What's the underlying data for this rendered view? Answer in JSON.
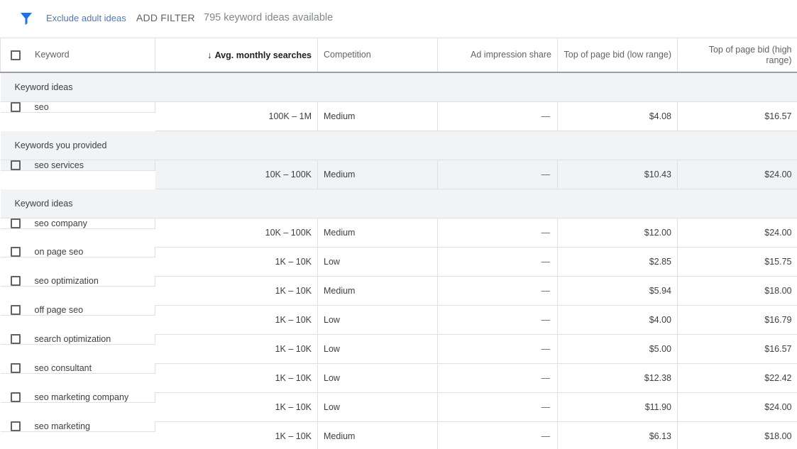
{
  "filterbar": {
    "icon": "filter-icon",
    "exclude_label": "Exclude adult ideas",
    "add_filter_label": "ADD FILTER",
    "available_text": "795 keyword ideas available"
  },
  "table": {
    "headers": {
      "keyword": "Keyword",
      "searches": "Avg. monthly searches",
      "competition": "Competition",
      "impression": "Ad impression share",
      "bid_low": "Top of page bid (low range)",
      "bid_high": "Top of page bid (high range)"
    },
    "sort_icon": "arrow-down-icon",
    "sections": {
      "ideas_1": "Keyword ideas",
      "provided": "Keywords you provided",
      "ideas_2": "Keyword ideas"
    },
    "rows": [
      {
        "keyword": "seo",
        "searches": "100K – 1M",
        "competition": "Medium",
        "impression": "—",
        "bid_low": "$4.08",
        "bid_high": "$16.57"
      },
      {
        "keyword": "seo services",
        "searches": "10K – 100K",
        "competition": "Medium",
        "impression": "—",
        "bid_low": "$10.43",
        "bid_high": "$24.00"
      },
      {
        "keyword": "seo company",
        "searches": "10K – 100K",
        "competition": "Medium",
        "impression": "—",
        "bid_low": "$12.00",
        "bid_high": "$24.00"
      },
      {
        "keyword": "on page seo",
        "searches": "1K – 10K",
        "competition": "Low",
        "impression": "—",
        "bid_low": "$2.85",
        "bid_high": "$15.75"
      },
      {
        "keyword": "seo optimization",
        "searches": "1K – 10K",
        "competition": "Medium",
        "impression": "—",
        "bid_low": "$5.94",
        "bid_high": "$18.00"
      },
      {
        "keyword": "off page seo",
        "searches": "1K – 10K",
        "competition": "Low",
        "impression": "—",
        "bid_low": "$4.00",
        "bid_high": "$16.79"
      },
      {
        "keyword": "search optimization",
        "searches": "1K – 10K",
        "competition": "Low",
        "impression": "—",
        "bid_low": "$5.00",
        "bid_high": "$16.57"
      },
      {
        "keyword": "seo consultant",
        "searches": "1K – 10K",
        "competition": "Low",
        "impression": "—",
        "bid_low": "$12.38",
        "bid_high": "$22.42"
      },
      {
        "keyword": "seo marketing company",
        "searches": "1K – 10K",
        "competition": "Low",
        "impression": "—",
        "bid_low": "$11.90",
        "bid_high": "$24.00"
      },
      {
        "keyword": "seo marketing",
        "searches": "1K – 10K",
        "competition": "Medium",
        "impression": "—",
        "bid_low": "$6.13",
        "bid_high": "$18.00"
      }
    ]
  },
  "colors": {
    "accent": "#1a73e8",
    "link": "#4a78c8",
    "section_bg": "#f1f3f4"
  }
}
